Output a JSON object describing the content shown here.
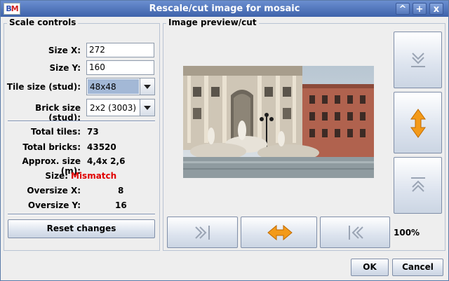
{
  "window": {
    "title": "Rescale/cut image for mosaic",
    "icon_text_b": "B",
    "icon_text_m": "M",
    "controls": {
      "minimize": "^",
      "maximize": "+",
      "close": "x"
    }
  },
  "scale_controls": {
    "title": "Scale controls",
    "size_x_label": "Size X:",
    "size_x_value": "272",
    "size_y_label": "Size Y:",
    "size_y_value": "160",
    "tile_size_label": "Tile size (stud):",
    "tile_size_value": "48x48",
    "brick_size_label": "Brick size (stud):",
    "brick_size_value": "2x2 (3003)",
    "total_tiles_label": "Total tiles:",
    "total_tiles_value": "73",
    "total_bricks_label": "Total bricks:",
    "total_bricks_value": "43520",
    "approx_size_label": "Approx. size (m):",
    "approx_size_value": "4,4x 2,6",
    "size_label": "Size:",
    "size_value": "Mismatch",
    "oversize_x_label": "Oversize X:",
    "oversize_x_value": "8",
    "oversize_y_label": "Oversize Y:",
    "oversize_y_value": "16",
    "reset_label": "Reset changes"
  },
  "preview": {
    "title": "Image preview/cut",
    "zoom": "100%"
  },
  "footer": {
    "ok_label": "OK",
    "cancel_label": "Cancel"
  },
  "colors": {
    "titlebar": "#3e62aa",
    "mismatch": "#e00000",
    "arrow_orange": "#f39a1a"
  }
}
